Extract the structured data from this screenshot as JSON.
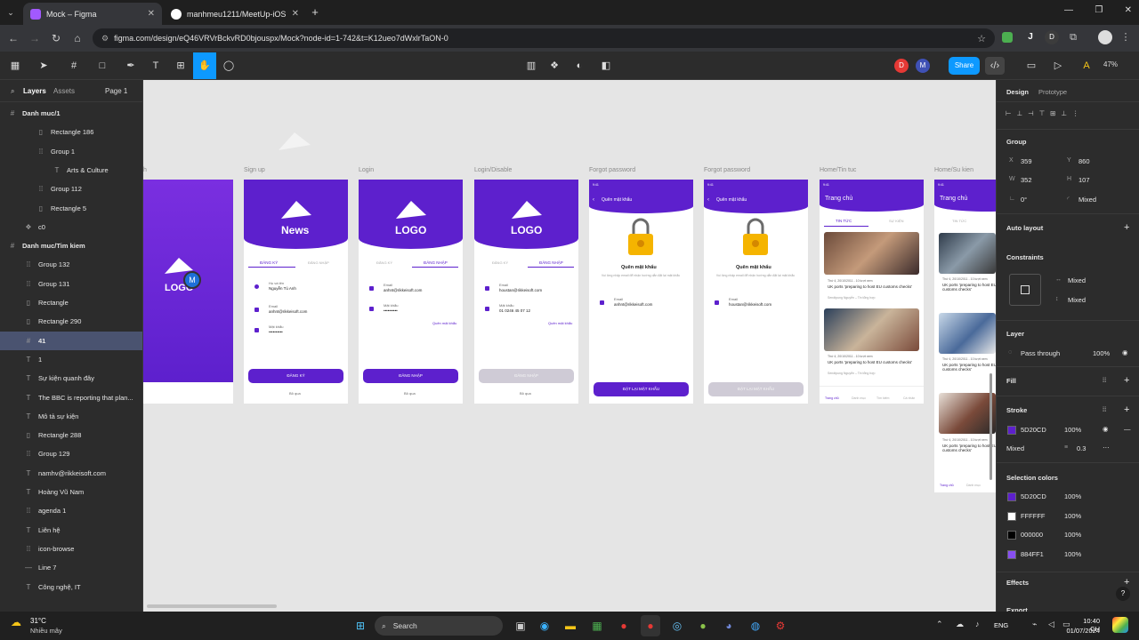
{
  "browser": {
    "tabs": [
      {
        "title": "Mock – Figma"
      },
      {
        "title": "manhmeu1211/MeetUp-iOS"
      }
    ],
    "url": "figma.com/design/eQ46VRVrBckvRD0bjouspx/Mock?node-id=1-742&t=K12ueo7dWxlrTaON-0",
    "profile_badges": [
      "J",
      "D"
    ]
  },
  "figma": {
    "share_label": "Share",
    "zoom": "47%",
    "avatars": [
      "D",
      "M"
    ],
    "left_tabs": {
      "layers": "Layers",
      "assets": "Assets",
      "page": "Page 1"
    },
    "layers": [
      {
        "label": "Danh muc/1",
        "icon": "frame-icon"
      },
      {
        "label": "Rectangle 186",
        "icon": "rect-icon"
      },
      {
        "label": "Group 1",
        "icon": "group-icon"
      },
      {
        "label": "Arts & Culture",
        "icon": "text-icon"
      },
      {
        "label": "Group 112",
        "icon": "group-icon"
      },
      {
        "label": "Rectangle 5",
        "icon": "rect-icon"
      },
      {
        "label": "c0",
        "icon": "component-icon"
      },
      {
        "label": "Danh muc/Tim kiem",
        "icon": "frame-icon"
      },
      {
        "label": "Group 132",
        "icon": "group-icon"
      },
      {
        "label": "Group 131",
        "icon": "group-icon"
      },
      {
        "label": "Rectangle",
        "icon": "rect-icon"
      },
      {
        "label": "Rectangle 290",
        "icon": "rect-icon"
      },
      {
        "label": "41",
        "icon": "frame-icon"
      },
      {
        "label": "1",
        "icon": "text-icon"
      },
      {
        "label": "Sự kiện quanh đây",
        "icon": "text-icon"
      },
      {
        "label": "The BBC is reporting that plan...",
        "icon": "text-icon"
      },
      {
        "label": "Mô tả sự kiện",
        "icon": "text-icon"
      },
      {
        "label": "Rectangle 288",
        "icon": "rect-icon"
      },
      {
        "label": "Group 129",
        "icon": "group-icon"
      },
      {
        "label": "namhv@rikkeisoft.com",
        "icon": "text-icon"
      },
      {
        "label": "Hoàng Vũ Nam",
        "icon": "text-icon"
      },
      {
        "label": "agenda 1",
        "icon": "group-icon"
      },
      {
        "label": "Liên hệ",
        "icon": "text-icon"
      },
      {
        "label": "icon-browse",
        "icon": "group-icon"
      },
      {
        "label": "Line 7",
        "icon": "line-icon"
      },
      {
        "label": "Công nghệ, IT",
        "icon": "text-icon"
      }
    ],
    "frames": [
      {
        "label": "h"
      },
      {
        "label": "Sign up"
      },
      {
        "label": "Login"
      },
      {
        "label": "Login/Disable"
      },
      {
        "label": "Forgot password"
      },
      {
        "label": "Forgot password"
      },
      {
        "label": "Home/Tin tuc"
      },
      {
        "label": "Home/Su kien"
      }
    ],
    "mock": {
      "logo": "LOGO",
      "news": "News",
      "tab_signup": "ĐĂNG KÝ",
      "tab_login": "ĐĂNG NHẬP",
      "name_label": "Họ và tên",
      "name_value": "Nguyễn Tú Anh",
      "email_label": "Email",
      "email_value": "anhnt@rikkeisoft.com",
      "email_value2": "houstan@rikkeisoft.com",
      "password_label": "Mật khẩu",
      "password_value": "••••••••••",
      "password_value2": "01 0246 45 07 12",
      "forgot_link": "Quên mật khẩu",
      "signup_btn": "ĐĂNG KÝ",
      "login_btn": "ĐĂNG NHẬP",
      "skip": "Bỏ qua",
      "status_time": "9:41",
      "forgot_title": "Quên mật khẩu",
      "forgot_heading": "Quên mật khẩu",
      "forgot_desc": "Vui lòng nhập email để nhận hướng dẫn đặt lại mật khẩu",
      "reset_btn": "ĐẶT LẠI MẬT KHẨU",
      "home_title": "Trang chủ",
      "tab_news": "TIN TỨC",
      "tab_events": "SỰ KIỆN",
      "article_date": "Thứ 4, 20/10/2011 - 10 lượt xem",
      "article_title": "UK ports 'preparing to host EU customs checks'",
      "article_author": "Sendtpung Nguyễn – Tin tổng hợp",
      "nav": [
        "Trang chủ",
        "Danh mục",
        "Tìm kiếm",
        "Cá nhân"
      ]
    },
    "design_panel": {
      "tabs": {
        "design": "Design",
        "prototype": "Prototype"
      },
      "group_label": "Group",
      "x": "359",
      "y": "860",
      "w": "352",
      "h": "107",
      "rotation": "0°",
      "radius": "Mixed",
      "auto_layout": "Auto layout",
      "constraints": "Constraints",
      "constraint_h": "Mixed",
      "constraint_v": "Mixed",
      "layer": "Layer",
      "blend": "Pass through",
      "opacity": "100%",
      "fill": "Fill",
      "stroke": "Stroke",
      "stroke_color": "5D20CD",
      "stroke_opacity": "100%",
      "stroke_mode": "Mixed",
      "stroke_width": "0.3",
      "selection_colors": "Selection colors",
      "colors": [
        {
          "hex": "5D20CD",
          "opacity": "100%",
          "swatch": "#5d20cd"
        },
        {
          "hex": "FFFFFF",
          "opacity": "100%",
          "swatch": "#ffffff"
        },
        {
          "hex": "000000",
          "opacity": "100%",
          "swatch": "#000000"
        },
        {
          "hex": "884FF1",
          "opacity": "100%",
          "swatch": "#884ff1"
        }
      ],
      "effects": "Effects",
      "export": "Export"
    }
  },
  "taskbar": {
    "weather_temp": "31°C",
    "weather_desc": "Nhiều mây",
    "search": "Search",
    "lang": "ENG",
    "time": "10:40 CH",
    "date": "01/07/2024"
  },
  "colors": {
    "brand": "#5d20cd",
    "figma_blue": "#0d99ff",
    "canvas": "#e5e5e5"
  }
}
